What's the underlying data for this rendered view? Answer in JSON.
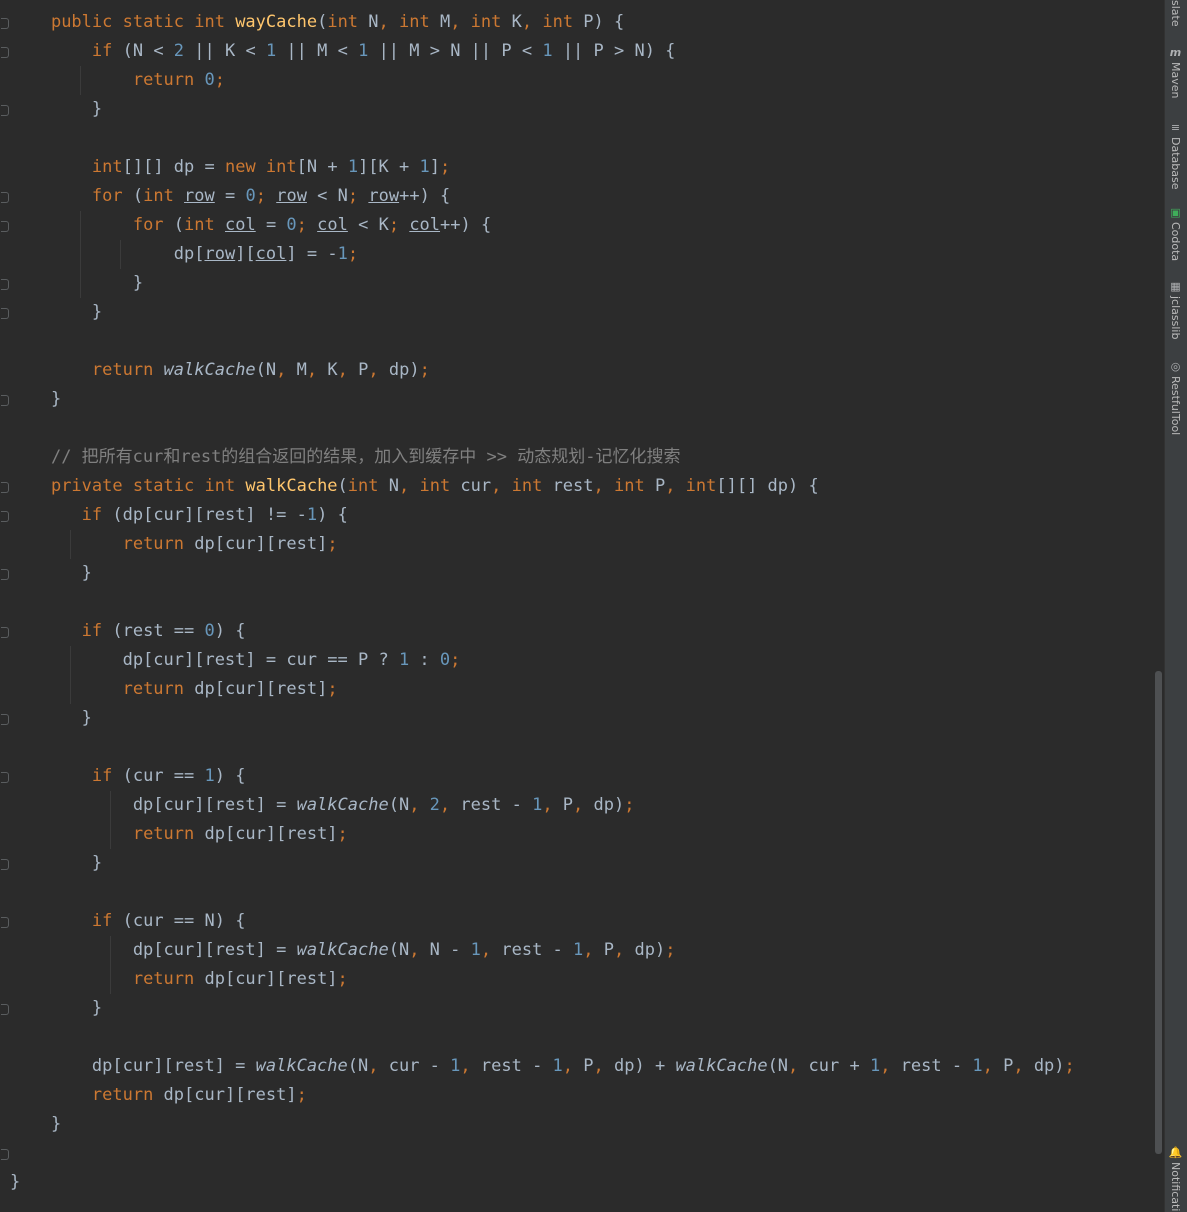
{
  "code_lines": [
    [
      [
        "t",
        "    "
      ],
      [
        "kw",
        "public static int "
      ],
      [
        "fn",
        "wayCache"
      ],
      [
        "t",
        "("
      ],
      [
        "kw",
        "int "
      ],
      [
        "t",
        "N"
      ],
      [
        "kw",
        ", int "
      ],
      [
        "t",
        "M"
      ],
      [
        "kw",
        ", int "
      ],
      [
        "t",
        "K"
      ],
      [
        "kw",
        ", int "
      ],
      [
        "t",
        "P) {"
      ]
    ],
    [
      [
        "t",
        "        "
      ],
      [
        "kw",
        "if "
      ],
      [
        "t",
        "(N < "
      ],
      [
        "num",
        "2"
      ],
      [
        "t",
        " || K < "
      ],
      [
        "num",
        "1"
      ],
      [
        "t",
        " || M < "
      ],
      [
        "num",
        "1"
      ],
      [
        "t",
        " || M > N || P < "
      ],
      [
        "num",
        "1"
      ],
      [
        "t",
        " || P > N) {"
      ]
    ],
    [
      [
        "t",
        "            "
      ],
      [
        "kw",
        "return "
      ],
      [
        "num",
        "0"
      ],
      [
        "kw",
        ";"
      ]
    ],
    [
      [
        "t",
        "        }"
      ]
    ],
    [
      [
        "t",
        ""
      ]
    ],
    [
      [
        "t",
        "        "
      ],
      [
        "kw",
        "int"
      ],
      [
        "t",
        "[][] dp = "
      ],
      [
        "kw",
        "new int"
      ],
      [
        "t",
        "[N + "
      ],
      [
        "num",
        "1"
      ],
      [
        "t",
        "][K + "
      ],
      [
        "num",
        "1"
      ],
      [
        "t",
        "]"
      ],
      [
        "kw",
        ";"
      ]
    ],
    [
      [
        "t",
        "        "
      ],
      [
        "kw",
        "for "
      ],
      [
        "t",
        "("
      ],
      [
        "kw",
        "int "
      ],
      [
        "u",
        "row"
      ],
      [
        "t",
        " = "
      ],
      [
        "num",
        "0"
      ],
      [
        "kw",
        "; "
      ],
      [
        "u",
        "row"
      ],
      [
        "t",
        " < N"
      ],
      [
        "kw",
        "; "
      ],
      [
        "u",
        "row"
      ],
      [
        "t",
        "++) {"
      ]
    ],
    [
      [
        "t",
        "            "
      ],
      [
        "kw",
        "for "
      ],
      [
        "t",
        "("
      ],
      [
        "kw",
        "int "
      ],
      [
        "u",
        "col"
      ],
      [
        "t",
        " = "
      ],
      [
        "num",
        "0"
      ],
      [
        "kw",
        "; "
      ],
      [
        "u",
        "col"
      ],
      [
        "t",
        " < K"
      ],
      [
        "kw",
        "; "
      ],
      [
        "u",
        "col"
      ],
      [
        "t",
        "++) {"
      ]
    ],
    [
      [
        "t",
        "                dp["
      ],
      [
        "u",
        "row"
      ],
      [
        "t",
        "]["
      ],
      [
        "u",
        "col"
      ],
      [
        "t",
        "] = -"
      ],
      [
        "num",
        "1"
      ],
      [
        "kw",
        ";"
      ]
    ],
    [
      [
        "t",
        "            }"
      ]
    ],
    [
      [
        "t",
        "        }"
      ]
    ],
    [
      [
        "t",
        ""
      ]
    ],
    [
      [
        "t",
        "        "
      ],
      [
        "kw",
        "return "
      ],
      [
        "it",
        "walkCache"
      ],
      [
        "t",
        "(N"
      ],
      [
        "kw",
        ", "
      ],
      [
        "t",
        "M"
      ],
      [
        "kw",
        ", "
      ],
      [
        "t",
        "K"
      ],
      [
        "kw",
        ", "
      ],
      [
        "t",
        "P"
      ],
      [
        "kw",
        ", "
      ],
      [
        "t",
        "dp)"
      ],
      [
        "kw",
        ";"
      ]
    ],
    [
      [
        "t",
        "    }"
      ]
    ],
    [
      [
        "t",
        ""
      ]
    ],
    [
      [
        "t",
        "    "
      ],
      [
        "cm",
        "// 把所有cur和rest的组合返回的结果，加入到缓存中 >> 动态规划-记忆化搜索"
      ]
    ],
    [
      [
        "t",
        "    "
      ],
      [
        "kw",
        "private static int "
      ],
      [
        "fn",
        "walkCache"
      ],
      [
        "t",
        "("
      ],
      [
        "kw",
        "int "
      ],
      [
        "t",
        "N"
      ],
      [
        "kw",
        ", int "
      ],
      [
        "t",
        "cur"
      ],
      [
        "kw",
        ", int "
      ],
      [
        "t",
        "rest"
      ],
      [
        "kw",
        ", int "
      ],
      [
        "t",
        "P"
      ],
      [
        "kw",
        ", int"
      ],
      [
        "t",
        "[][] dp) {"
      ]
    ],
    [
      [
        "t",
        "       "
      ],
      [
        "kw",
        "if "
      ],
      [
        "t",
        "(dp[cur][rest] != -"
      ],
      [
        "num",
        "1"
      ],
      [
        "t",
        ") {"
      ]
    ],
    [
      [
        "t",
        "           "
      ],
      [
        "kw",
        "return "
      ],
      [
        "t",
        "dp[cur][rest]"
      ],
      [
        "kw",
        ";"
      ]
    ],
    [
      [
        "t",
        "       }"
      ]
    ],
    [
      [
        "t",
        ""
      ]
    ],
    [
      [
        "t",
        "       "
      ],
      [
        "kw",
        "if "
      ],
      [
        "t",
        "(rest == "
      ],
      [
        "num",
        "0"
      ],
      [
        "t",
        ") {"
      ]
    ],
    [
      [
        "t",
        "           dp[cur][rest] = cur == P ? "
      ],
      [
        "num",
        "1"
      ],
      [
        "t",
        " : "
      ],
      [
        "num",
        "0"
      ],
      [
        "kw",
        ";"
      ]
    ],
    [
      [
        "t",
        "           "
      ],
      [
        "kw",
        "return "
      ],
      [
        "t",
        "dp[cur][rest]"
      ],
      [
        "kw",
        ";"
      ]
    ],
    [
      [
        "t",
        "       }"
      ]
    ],
    [
      [
        "t",
        ""
      ]
    ],
    [
      [
        "t",
        "        "
      ],
      [
        "kw",
        "if "
      ],
      [
        "t",
        "(cur == "
      ],
      [
        "num",
        "1"
      ],
      [
        "t",
        ") {"
      ]
    ],
    [
      [
        "t",
        "            dp[cur][rest] = "
      ],
      [
        "it",
        "walkCache"
      ],
      [
        "t",
        "(N"
      ],
      [
        "kw",
        ", "
      ],
      [
        "num",
        "2"
      ],
      [
        "kw",
        ", "
      ],
      [
        "t",
        "rest - "
      ],
      [
        "num",
        "1"
      ],
      [
        "kw",
        ", "
      ],
      [
        "t",
        "P"
      ],
      [
        "kw",
        ", "
      ],
      [
        "t",
        "dp)"
      ],
      [
        "kw",
        ";"
      ]
    ],
    [
      [
        "t",
        "            "
      ],
      [
        "kw",
        "return "
      ],
      [
        "t",
        "dp[cur][rest]"
      ],
      [
        "kw",
        ";"
      ]
    ],
    [
      [
        "t",
        "        }"
      ]
    ],
    [
      [
        "t",
        ""
      ]
    ],
    [
      [
        "t",
        "        "
      ],
      [
        "kw",
        "if "
      ],
      [
        "t",
        "(cur == N) {"
      ]
    ],
    [
      [
        "t",
        "            dp[cur][rest] = "
      ],
      [
        "it",
        "walkCache"
      ],
      [
        "t",
        "(N"
      ],
      [
        "kw",
        ", "
      ],
      [
        "t",
        "N - "
      ],
      [
        "num",
        "1"
      ],
      [
        "kw",
        ", "
      ],
      [
        "t",
        "rest - "
      ],
      [
        "num",
        "1"
      ],
      [
        "kw",
        ", "
      ],
      [
        "t",
        "P"
      ],
      [
        "kw",
        ", "
      ],
      [
        "t",
        "dp)"
      ],
      [
        "kw",
        ";"
      ]
    ],
    [
      [
        "t",
        "            "
      ],
      [
        "kw",
        "return "
      ],
      [
        "t",
        "dp[cur][rest]"
      ],
      [
        "kw",
        ";"
      ]
    ],
    [
      [
        "t",
        "        }"
      ]
    ],
    [
      [
        "t",
        ""
      ]
    ],
    [
      [
        "t",
        "        dp[cur][rest] = "
      ],
      [
        "it",
        "walkCache"
      ],
      [
        "t",
        "(N"
      ],
      [
        "kw",
        ", "
      ],
      [
        "t",
        "cur - "
      ],
      [
        "num",
        "1"
      ],
      [
        "kw",
        ", "
      ],
      [
        "t",
        "rest - "
      ],
      [
        "num",
        "1"
      ],
      [
        "kw",
        ", "
      ],
      [
        "t",
        "P"
      ],
      [
        "kw",
        ", "
      ],
      [
        "t",
        "dp) + "
      ],
      [
        "it",
        "walkCache"
      ],
      [
        "t",
        "(N"
      ],
      [
        "kw",
        ", "
      ],
      [
        "t",
        "cur + "
      ],
      [
        "num",
        "1"
      ],
      [
        "kw",
        ", "
      ],
      [
        "t",
        "rest - "
      ],
      [
        "num",
        "1"
      ],
      [
        "kw",
        ", "
      ],
      [
        "t",
        "P"
      ],
      [
        "kw",
        ", "
      ],
      [
        "t",
        "dp)"
      ],
      [
        "kw",
        ";"
      ]
    ],
    [
      [
        "t",
        "        "
      ],
      [
        "kw",
        "return "
      ],
      [
        "t",
        "dp[cur][rest]"
      ],
      [
        "kw",
        ";"
      ]
    ],
    [
      [
        "t",
        "    }"
      ]
    ],
    [
      [
        "t",
        ""
      ]
    ],
    [
      [
        "t",
        "}"
      ]
    ]
  ],
  "tool_windows": [
    {
      "label": "slate",
      "icon": ""
    },
    {
      "label": "Maven",
      "icon": "m"
    },
    {
      "label": "Database",
      "icon": "≡"
    },
    {
      "label": "Codota",
      "icon": "▣"
    },
    {
      "label": "jclasslib",
      "icon": "▦"
    },
    {
      "label": "RestfulTool",
      "icon": "◎"
    },
    {
      "label": "Notificati",
      "icon": "🔔"
    }
  ],
  "colors": {
    "background": "#2b2b2b",
    "keyword": "#cc7832",
    "number": "#6897bb",
    "method_declaration": "#ffc66d",
    "identifier": "#a9b7c6",
    "comment": "#808080"
  }
}
